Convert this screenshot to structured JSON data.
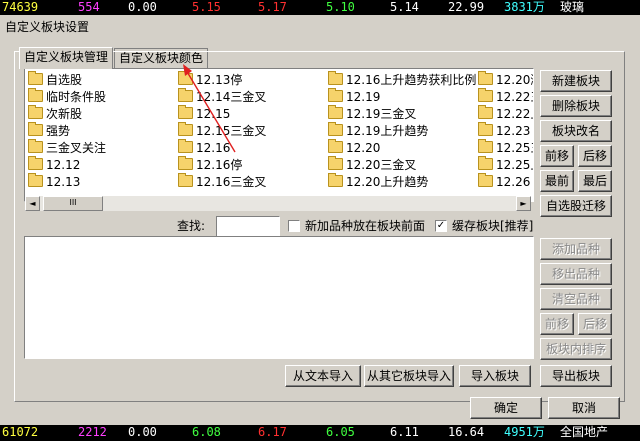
{
  "ticker_top": [
    "74639",
    "554",
    "0.00",
    "5.15",
    "5.17",
    "5.10",
    "5.14",
    "22.99",
    "3831万",
    "玻璃"
  ],
  "ticker_bottom": [
    "61072",
    "2212",
    "0.00",
    "6.08",
    "6.17",
    "6.05",
    "6.11",
    "16.64",
    "4951万",
    "全国地产"
  ],
  "colors": {
    "white": "#ffffff",
    "magenta": "#ff40ff",
    "red": "#ff3030",
    "green": "#40ff40",
    "cyan": "#40ffff",
    "yellow": "#ffff40",
    "arrow": "#e02020"
  },
  "window": {
    "title": "自定义板块设置"
  },
  "tabs": [
    "自定义板块管理",
    "自定义板块颜色"
  ],
  "columns": [
    [
      "自选股",
      "临时条件股",
      "次新股",
      "强势",
      "三金叉关注",
      "12.12",
      "12.13"
    ],
    [
      "12.13停",
      "12.14三金叉",
      "12.15",
      "12.15三金叉",
      "12.16",
      "12.16停",
      "12.16三金叉"
    ],
    [
      "12.16上升趋势获利比例",
      "12.19",
      "12.19三金叉",
      "12.19上升趋势",
      "12.20",
      "12.20三金叉",
      "12.20上升趋势"
    ],
    [
      "12.20涨",
      "12.22三",
      "12.22上",
      "12.23",
      "12.25三",
      "12.25上",
      "12.26"
    ]
  ],
  "scrollbar": {
    "left": "◄",
    "right": "►",
    "thumb": "III"
  },
  "side_buttons": {
    "new": "新建板块",
    "delete": "删除板块",
    "rename": "板块改名",
    "forward": "前移",
    "backward": "后移",
    "first": "最前",
    "last": "最后",
    "migrate": "自选股迁移"
  },
  "search": {
    "label": "查找:",
    "value": ""
  },
  "options": {
    "add_front": {
      "label": "新加品种放在板块前面",
      "checked": false
    },
    "cache": {
      "label": "缓存板块[推荐]",
      "checked": true
    }
  },
  "lower_buttons": {
    "add_item": "添加品种",
    "remove_item": "移出品种",
    "clear_items": "清空品种",
    "forward": "前移",
    "backward": "后移",
    "sort": "板块内排序"
  },
  "import_buttons": {
    "from_text": "从文本导入",
    "from_other": "从其它板块导入",
    "import": "导入板块",
    "export": "导出板块"
  },
  "footer": {
    "ok": "确定",
    "cancel": "取消"
  }
}
